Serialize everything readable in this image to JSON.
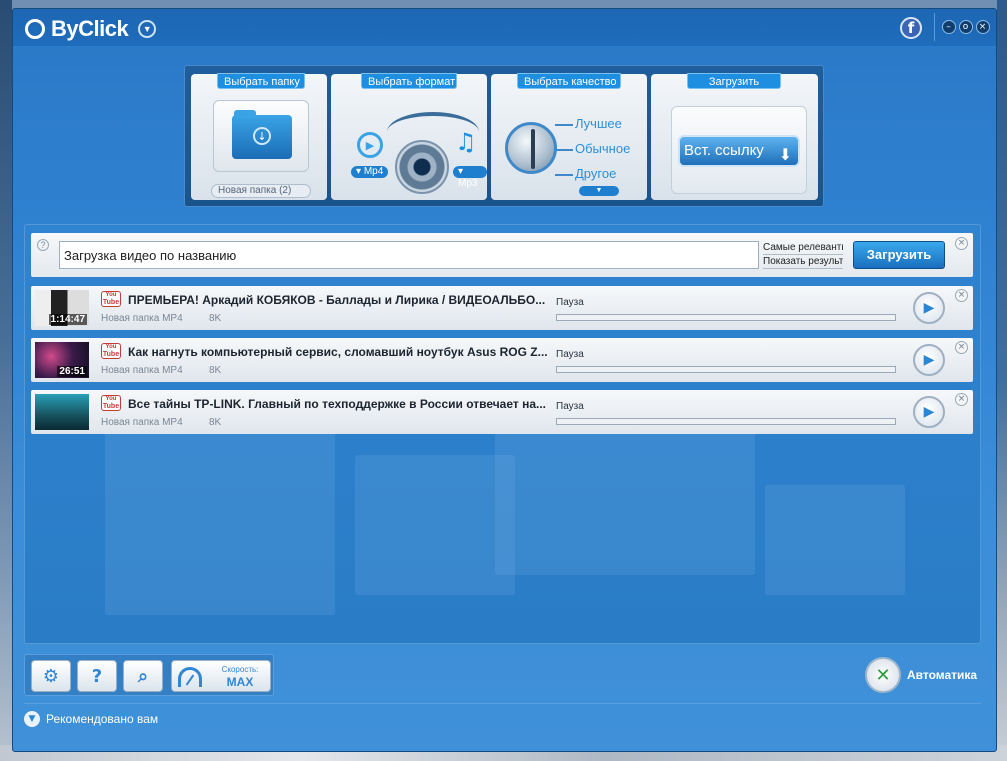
{
  "app": {
    "name": "ByClick",
    "facebook_glyph": "f",
    "window_controls": [
      "–",
      "o",
      "×"
    ]
  },
  "steps": {
    "folder": {
      "label": "Выбрать папку",
      "value": "Новая папка (2)"
    },
    "format": {
      "label": "Выбрать формат",
      "video": "Mp4",
      "audio": "Mp3"
    },
    "quality": {
      "label": "Выбрать качество",
      "options": [
        "Лучшее",
        "Обычное",
        "Другое"
      ]
    },
    "download": {
      "label": "Загрузить",
      "paste_label": "Вст. ссылку"
    }
  },
  "search": {
    "help": "?",
    "value": "Загрузка видео по названию",
    "option_relevant": "Самые релевантны",
    "option_show": "Показать результат",
    "button": "Загрузить"
  },
  "downloads": [
    {
      "title": "ПРЕМЬЕРА! Аркадий КОБЯКОВ -  Баллады и Лирика / ВИДЕОАЛЬБО...",
      "duration": "1:14:47",
      "folder": "Новая папка MP4",
      "size": "8K",
      "status": "Пауза",
      "progress": 0
    },
    {
      "title": "Как нагнуть компьютерный сервис, сломавший ноутбук Asus ROG Z...",
      "duration": "26:51",
      "folder": "Новая папка MP4",
      "size": "8K",
      "status": "Пауза",
      "progress": 0
    },
    {
      "title": "Все тайны TP-LINK. Главный по техподдержке в России отвечает на...",
      "duration": "",
      "folder": "Новая папка MP4",
      "size": "8K",
      "status": "Пауза",
      "progress": 0
    }
  ],
  "toolbar": {
    "speed_label": "Скорость:",
    "speed_value": "MAX"
  },
  "auto": {
    "label": "Автоматика"
  },
  "recommend": {
    "label": "Рекомендовано вам"
  },
  "colors": {
    "accent": "#2f86d6",
    "window": "#2f82d1"
  }
}
